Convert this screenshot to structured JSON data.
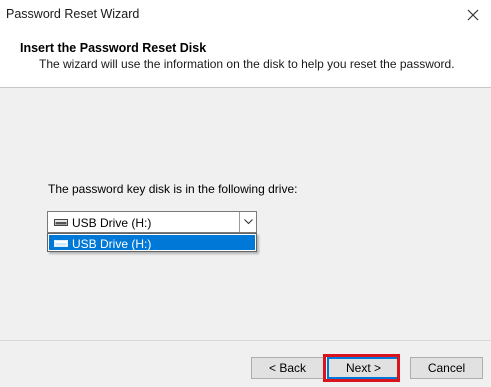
{
  "window": {
    "title": "Password Reset Wizard",
    "close_icon": "close-icon"
  },
  "header": {
    "heading": "Insert the Password Reset Disk",
    "subheading": "The wizard will use the information on the disk to help you reset the password."
  },
  "drive_select": {
    "label": "The password key disk is in the following drive:",
    "selected_value": "USB Drive (H:)",
    "options": [
      "USB Drive (H:)"
    ],
    "icon": "usb-drive-icon",
    "expanded": true
  },
  "buttons": {
    "back": "< Back",
    "next": "Next >",
    "cancel": "Cancel"
  },
  "colors": {
    "accent": "#0078d7",
    "highlight": "#d9141f"
  }
}
